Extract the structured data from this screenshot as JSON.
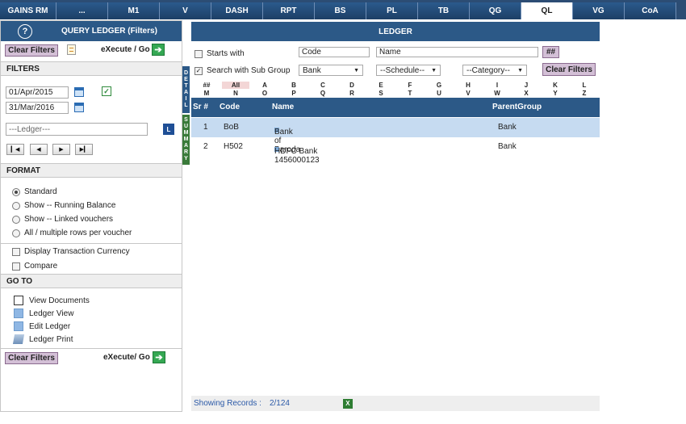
{
  "nav": {
    "tabs": [
      {
        "label": "GAINS RM",
        "width": 52
      },
      {
        "label": "...",
        "width": 78
      },
      {
        "label": "M1",
        "width": 64
      },
      {
        "label": "V",
        "width": 62
      },
      {
        "label": "DASH",
        "width": 66
      },
      {
        "label": "RPT",
        "width": 66
      },
      {
        "label": "BS",
        "width": 66
      },
      {
        "label": "PL",
        "width": 64
      },
      {
        "label": "TB",
        "width": 64
      },
      {
        "label": "QG",
        "width": 64
      },
      {
        "label": "QL",
        "width": 64
      },
      {
        "label": "VG",
        "width": 64
      },
      {
        "label": "CoA",
        "width": 64
      }
    ],
    "active": "QL"
  },
  "left": {
    "title": "QUERY LEDGER (Filters)",
    "help_icon": "?",
    "clear_filters": "Clear Filters",
    "execute_go": "eXecute / Go",
    "filters_heading": "FILTERS",
    "date_from": "01/Apr/2015",
    "date_to": "31/Mar/2016",
    "ledger_placeholder": "---Ledger---",
    "format_heading": "FORMAT",
    "format_options": [
      {
        "label": "Standard",
        "selected": true
      },
      {
        "label": "Show -- Running Balance",
        "selected": false
      },
      {
        "label": "Show -- Linked vouchers",
        "selected": false
      },
      {
        "label": "All / multiple rows per voucher",
        "selected": false
      }
    ],
    "display_currency": "Display Transaction Currency",
    "compare": "Compare",
    "goto_heading": "GO TO",
    "goto_items": [
      "View Documents",
      "Ledger View",
      "Edit Ledger",
      "Ledger Print"
    ],
    "clear_filters_bottom": "Clear Filters",
    "execute_go_bottom": "eXecute/ Go"
  },
  "side_tabs": {
    "detail": "DETAIL",
    "summary": "SUMMARY"
  },
  "ledger": {
    "title": "LEDGER",
    "starts_with": "Starts with",
    "code_value": "Code",
    "name_value": "Name",
    "hash_button": "##",
    "search_sub_group": "Search with Sub Group",
    "group_select": "Bank",
    "schedule_select": "--Schedule--",
    "category_select": "--Category--",
    "clear_filters": "Clear Filters",
    "alpha_row1": [
      "##",
      "All",
      "A",
      "B",
      "C",
      "D",
      "E",
      "F",
      "G",
      "H",
      "I",
      "J",
      "K",
      "L"
    ],
    "alpha_row2": [
      "M",
      "N",
      "O",
      "P",
      "Q",
      "R",
      "S",
      "T",
      "U",
      "V",
      "W",
      "X",
      "Y",
      "Z"
    ],
    "columns": {
      "sr": "Sr #",
      "code": "Code",
      "name": "Name",
      "parent": "ParentGroup"
    },
    "rows": [
      {
        "sr": "1",
        "code": "BoB",
        "name": "Bank of Baroda",
        "parent": "Bank"
      },
      {
        "sr": "2",
        "code": "H502",
        "name": "HDFC Bank 1456000123",
        "parent": "Bank"
      }
    ],
    "showing_label": "Showing Records :",
    "showing_value": "2/124"
  },
  "colors": {
    "header_blue": "#2c5987",
    "selected_row": "#c6dbf1",
    "button_lilac": "#d3bfd6"
  }
}
